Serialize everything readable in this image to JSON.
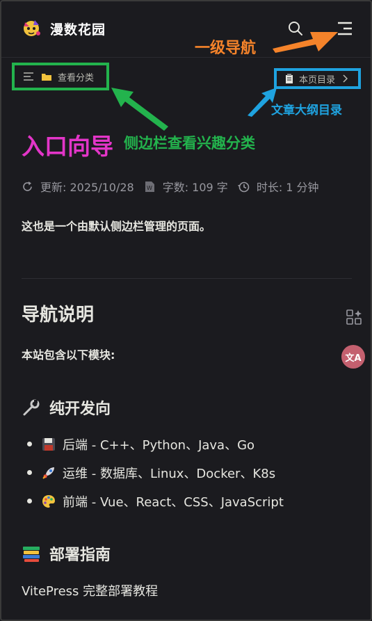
{
  "header": {
    "site_title": "漫数花园",
    "logo_icon": "mascot-logo-icon",
    "search_icon": "search-icon",
    "menu_icon": "menu-icon"
  },
  "annotations": {
    "primary_nav": "一级导航",
    "outline": "文章大纲目录",
    "entry_guide": "入口向导",
    "sidebar_hint": "侧边栏查看兴趣分类",
    "colors": {
      "orange": "#f5832a",
      "green": "#23b34d",
      "blue": "#1fa3e0",
      "magenta": "#e335c8"
    }
  },
  "localnav": {
    "category_label": "查看分类",
    "toc_label": "本页目录"
  },
  "meta": {
    "updated": "更新: 2025/10/28",
    "words": "字数: 109 字",
    "duration": "时长: 1 分钟"
  },
  "content": {
    "intro": "这也是一个由默认侧边栏管理的页面。",
    "h2": "导航说明",
    "modules_intro": "本站包含以下模块:",
    "section1_title": "纯开发向",
    "items": [
      {
        "emoji": "floppy-disk-icon",
        "text": "后端 - C++、Python、Java、Go"
      },
      {
        "emoji": "rocket-icon",
        "text": "运维 - 数据库、Linux、Docker、K8s"
      },
      {
        "emoji": "palette-icon",
        "text": "前端 - Vue、React、CSS、JavaScript"
      }
    ],
    "section2_title": "部署指南",
    "section2_text": "VitePress 完整部署教程"
  },
  "floating": {
    "translate_label": "文A"
  }
}
